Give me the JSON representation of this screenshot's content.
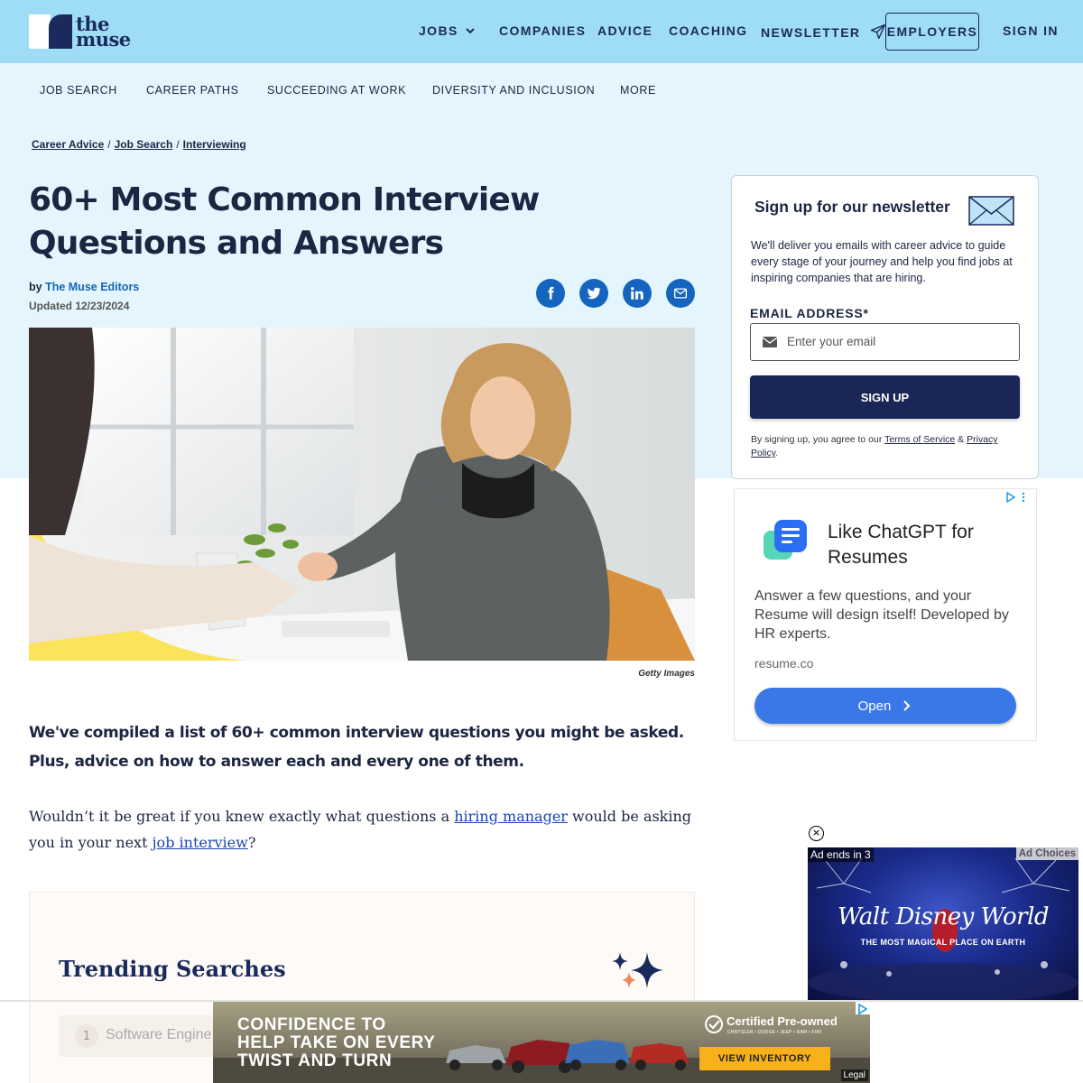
{
  "brand": {
    "logo_line1": "the",
    "logo_line2": "muse"
  },
  "topnav": {
    "jobs": "JOBS",
    "companies": "COMPANIES",
    "advice": "ADVICE",
    "coaching": "COACHING",
    "newsletter": "NEWSLETTER",
    "employers": "EMPLOYERS",
    "signin": "SIGN IN"
  },
  "subnav": [
    "JOB SEARCH",
    "CAREER PATHS",
    "SUCCEEDING AT WORK",
    "DIVERSITY AND INCLUSION",
    "MORE"
  ],
  "breadcrumb": [
    "Career Advice",
    "Job Search",
    "Interviewing"
  ],
  "article": {
    "title": "60+ Most Common Interview Questions and Answers",
    "by": "by",
    "author": "The Muse Editors",
    "updated": "Updated 12/23/2024",
    "image_caption": "Getty Images",
    "lead": "We've compiled a list of 60+ common interview questions you might be asked. Plus, advice on how to answer each and every one of them.",
    "para_start": "Wouldn’t it be great if you knew exactly what questions a ",
    "link1": "hiring manager",
    "para_mid": " would be asking you in your next ",
    "link2": "job interview",
    "para_end": "?"
  },
  "share_icons": [
    "facebook-icon",
    "twitter-icon",
    "linkedin-icon",
    "email-icon"
  ],
  "trending": {
    "title": "Trending Searches",
    "items": [
      {
        "num": "1",
        "label": "Software Engine"
      }
    ]
  },
  "newsletter": {
    "title": "Sign up for our newsletter",
    "desc": "We'll deliver you emails with career advice to guide every stage of your journey and help you find jobs at inspiring companies that are hiring.",
    "email_label": "EMAIL ADDRESS*",
    "email_placeholder": "Enter your email",
    "button": "SIGN UP",
    "terms_prefix": "By signing up, you agree to our ",
    "terms_link": "Terms of Service",
    "terms_amp": " & ",
    "privacy_link": "Privacy Policy",
    "terms_end": "."
  },
  "ad_resume": {
    "title": "Like ChatGPT for Resumes",
    "body": "Answer a few questions, and your Resume will design itself! Developed by HR experts.",
    "domain": "resume.co",
    "button": "Open"
  },
  "ad_disney": {
    "ends": "Ad ends in 3",
    "choices": "Ad Choices",
    "brand": "Walt Disney World",
    "tagline": "THE MOST MAGICAL PLACE ON EARTH",
    "close": "×"
  },
  "ad_car": {
    "text_line1": "CONFIDENCE TO",
    "text_line2": "HELP TAKE ON EVERY",
    "text_line3": "TWIST AND TURN",
    "cpo": "Certified Pre-owned",
    "cpo_sub": "CHRYSLER • DODGE • JEEP • RAM • FIAT",
    "button": "VIEW INVENTORY",
    "legal": "Legal"
  },
  "colors": {
    "topnav_bg": "#9fdcf5",
    "subnav_bg": "#e4f5fd",
    "navy": "#1a2a5c",
    "share_blue": "#1565c0",
    "signup_btn": "#1a2656"
  }
}
